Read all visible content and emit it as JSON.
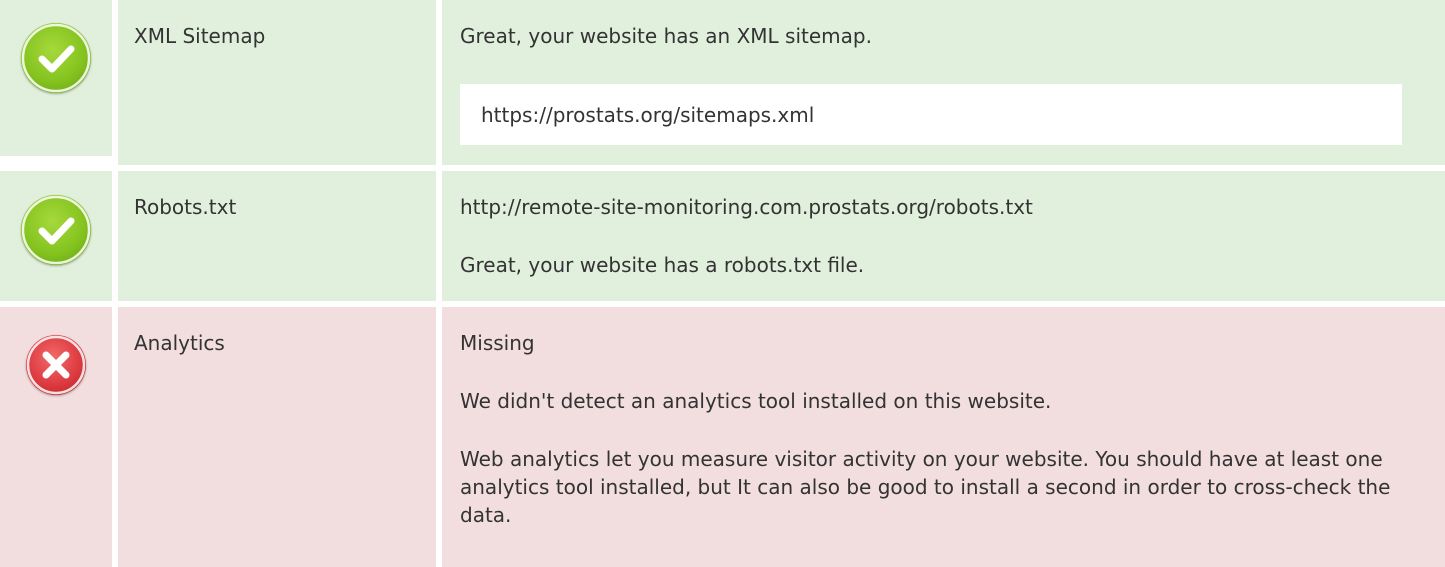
{
  "rows": [
    {
      "status": "pass",
      "status_color": "#74b518",
      "icon": "check-icon",
      "label": "XML Sitemap",
      "message": "Great, your website has an XML sitemap.",
      "url": "https://prostats.org/sitemaps.xml"
    },
    {
      "status": "pass",
      "status_color": "#74b518",
      "icon": "check-icon",
      "label": "Robots.txt",
      "url": "http://remote-site-monitoring.com.prostats.org/robots.txt",
      "message": "Great, your website has a robots.txt file."
    },
    {
      "status": "fail",
      "status_color": "#d9333a",
      "icon": "cross-icon",
      "label": "Analytics",
      "status_text": "Missing",
      "message": "We didn't detect an analytics tool installed on this website.",
      "advice": "Web analytics let you measure visitor activity on your website. You should have at least one analytics tool installed, but It can also be good to install a second in order to cross-check the data."
    }
  ],
  "colors": {
    "pass_bg": "#e1f0dc",
    "fail_bg": "#f2dedf"
  }
}
